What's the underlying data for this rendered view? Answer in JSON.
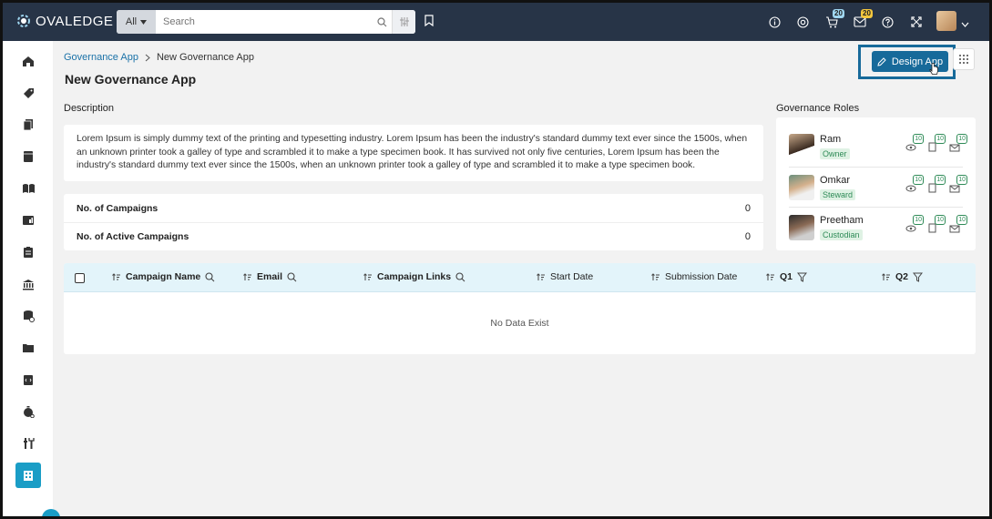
{
  "header": {
    "logo_text": "OVALEDGE",
    "search_scope": "All",
    "search_placeholder": "Search",
    "cart_count": "20",
    "notifications_count": "20"
  },
  "breadcrumb": {
    "parent": "Governance App",
    "current": "New Governance App"
  },
  "page": {
    "title": "New Governance App",
    "design_button": "Design App",
    "description_label": "Description",
    "description_text": "Lorem Ipsum is simply dummy text of the printing and typesetting industry. Lorem Ipsum has been the industry's standard dummy text ever since the 1500s, when an unknown printer took a galley of type and scrambled it to make a type specimen book. It has survived not only five centuries, Lorem Ipsum has been the industry's standard dummy text ever since the 1500s, when an unknown printer took a galley of type and scrambled it to make a type specimen book."
  },
  "stats": [
    {
      "label": "No. of Campaigns",
      "value": "0"
    },
    {
      "label": "No. of Active Campaigns",
      "value": "0"
    }
  ],
  "governance_roles": {
    "label": "Governance Roles",
    "roles": [
      {
        "name": "Ram",
        "role": "Owner",
        "counts": [
          "10",
          "10",
          "10"
        ]
      },
      {
        "name": "Omkar",
        "role": "Steward",
        "counts": [
          "10",
          "10",
          "10"
        ]
      },
      {
        "name": "Preetham",
        "role": "Custodian",
        "counts": [
          "10",
          "10",
          "10"
        ]
      }
    ]
  },
  "table": {
    "columns": [
      "Campaign Name",
      "Email",
      "Campaign Links",
      "Start Date",
      "Submission Date",
      "Q1",
      "Q2"
    ],
    "empty_text": "No Data Exist"
  },
  "colors": {
    "topbar": "#273447",
    "accent": "#176a9a",
    "active_nav": "#1a9dc6",
    "role_tag": "#2e8b57"
  }
}
